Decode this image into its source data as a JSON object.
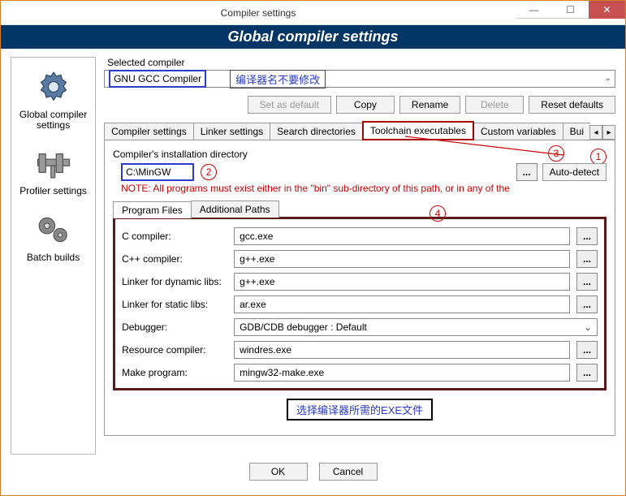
{
  "window": {
    "title": "Compiler settings"
  },
  "banner": "Global compiler settings",
  "sidebar": {
    "items": [
      {
        "label": "Global compiler settings"
      },
      {
        "label": "Profiler settings"
      },
      {
        "label": "Batch builds"
      }
    ]
  },
  "selected_compiler_label": "Selected compiler",
  "selected_compiler_value": "GNU GCC Compiler",
  "note_compiler": "编译器名不要修改",
  "buttons": {
    "set_default": "Set as default",
    "copy": "Copy",
    "rename": "Rename",
    "delete": "Delete",
    "reset": "Reset defaults",
    "ok": "OK",
    "cancel": "Cancel",
    "autodetect": "Auto-detect",
    "browse": "..."
  },
  "tabs": [
    "Compiler settings",
    "Linker settings",
    "Search directories",
    "Toolchain executables",
    "Custom variables",
    "Bui"
  ],
  "install_dir_label": "Compiler's installation directory",
  "install_dir_value": "C:\\MinGW",
  "note_path": "NOTE: All programs must exist either in the \"bin\" sub-directory of this path, or in any of the",
  "subtabs": [
    "Program Files",
    "Additional Paths"
  ],
  "programs": {
    "c_compiler": {
      "label": "C compiler:",
      "value": "gcc.exe"
    },
    "cpp_compiler": {
      "label": "C++ compiler:",
      "value": "g++.exe"
    },
    "linker_dyn": {
      "label": "Linker for dynamic libs:",
      "value": "g++.exe"
    },
    "linker_static": {
      "label": "Linker for static libs:",
      "value": "ar.exe"
    },
    "debugger": {
      "label": "Debugger:",
      "value": "GDB/CDB debugger : Default"
    },
    "resource": {
      "label": "Resource compiler:",
      "value": "windres.exe"
    },
    "make": {
      "label": "Make program:",
      "value": "mingw32-make.exe"
    }
  },
  "note_exe": "选择编译器所需的EXE文件",
  "markers": {
    "m1": "1",
    "m2": "2",
    "m3": "3",
    "m4": "4"
  }
}
